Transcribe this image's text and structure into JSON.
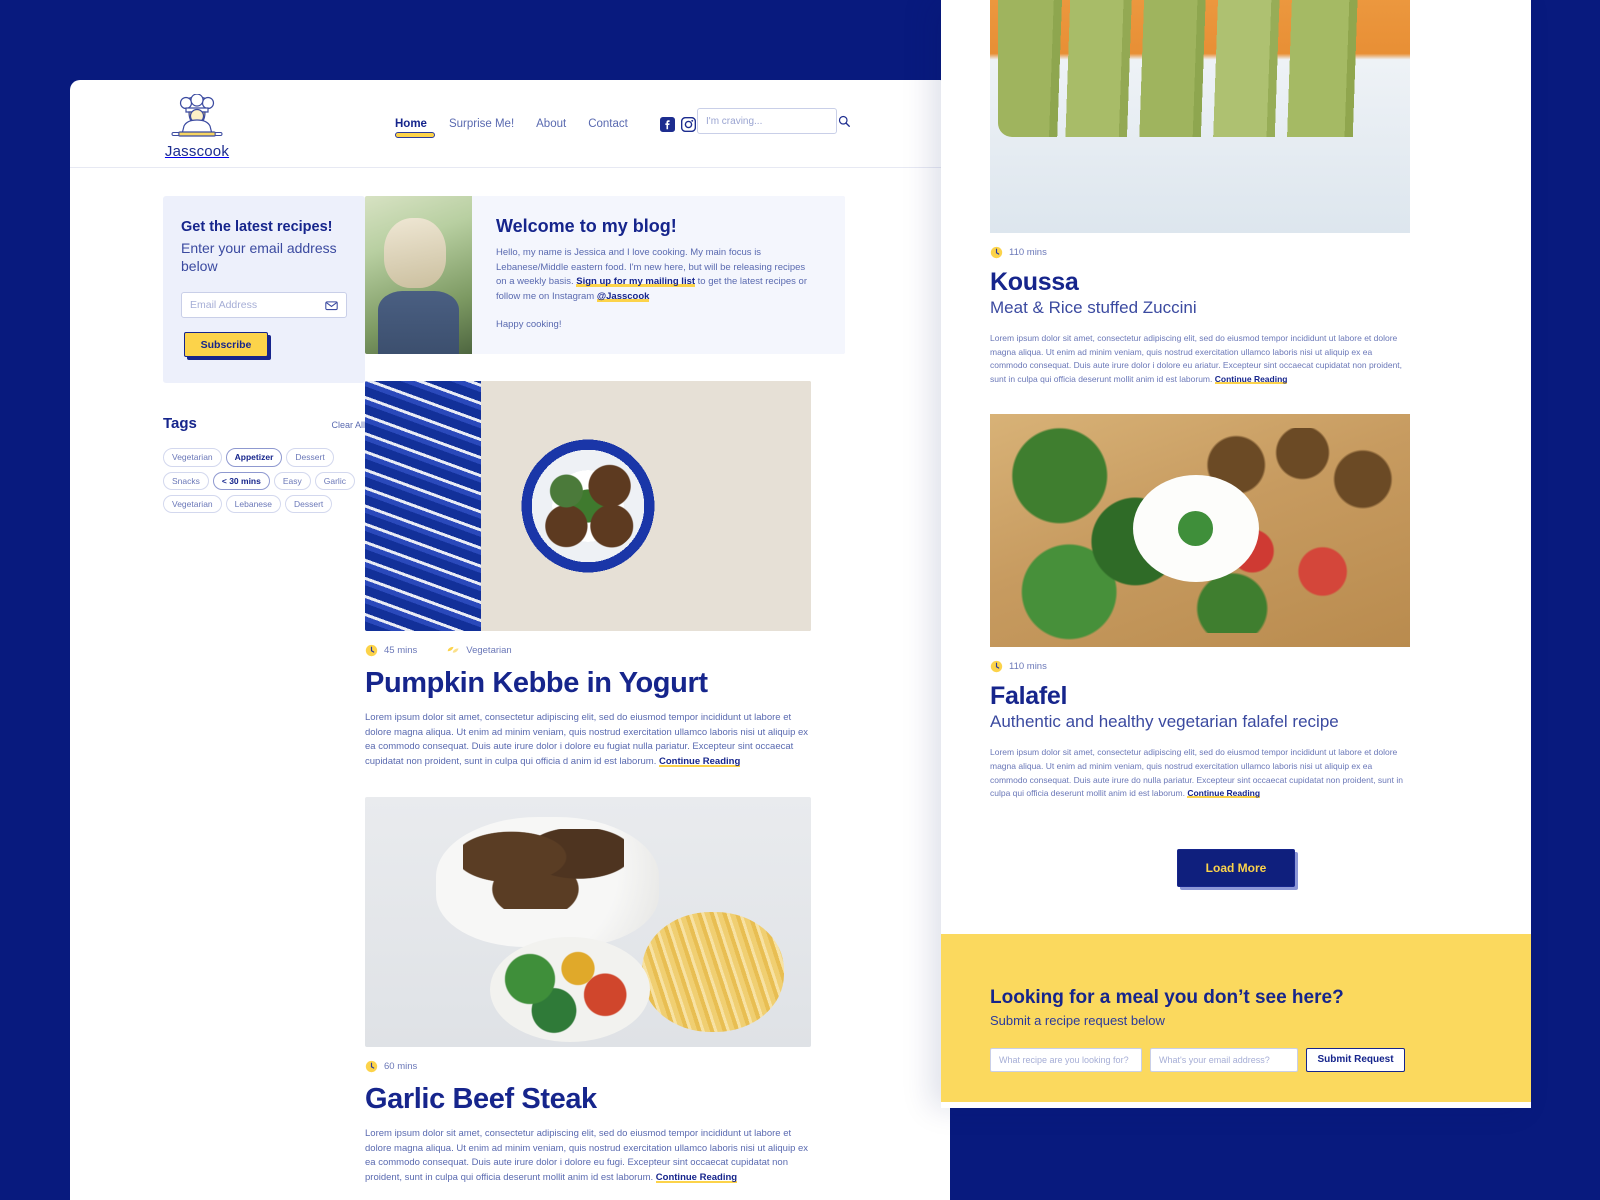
{
  "brand": {
    "name": "Jasscook",
    "logo_icon": "chef-logo-icon",
    "navy": "#16258c",
    "yellow": "#fcd34a",
    "page_bg": "#081a7e"
  },
  "nav": {
    "items": [
      {
        "label": "Home",
        "active": true
      },
      {
        "label": "Surprise Me!",
        "active": false
      },
      {
        "label": "About",
        "active": false
      },
      {
        "label": "Contact",
        "active": false
      }
    ],
    "socials": [
      {
        "name": "facebook-icon"
      },
      {
        "name": "instagram-icon"
      },
      {
        "name": "pinterest-icon"
      }
    ],
    "search": {
      "placeholder": "I'm craving...",
      "value": "",
      "icon": "search-icon"
    }
  },
  "sidebar": {
    "subscribe": {
      "title": "Get the latest recipes!",
      "subtitle": "Enter your email address below",
      "email_placeholder": "Email Address",
      "email_value": "",
      "mail_icon": "envelope-icon",
      "button_label": "Subscribe"
    },
    "tags": {
      "title": "Tags",
      "clear_label": "Clear All",
      "items": [
        {
          "label": "Vegetarian",
          "selected": false
        },
        {
          "label": "Appetizer",
          "selected": true
        },
        {
          "label": "Dessert",
          "selected": false
        },
        {
          "label": "Snacks",
          "selected": false
        },
        {
          "label": "< 30 mins",
          "selected": true
        },
        {
          "label": "Easy",
          "selected": false
        },
        {
          "label": "Garlic",
          "selected": false
        },
        {
          "label": "Vegetarian",
          "selected": false
        },
        {
          "label": "Lebanese",
          "selected": false
        },
        {
          "label": "Dessert",
          "selected": false
        }
      ]
    }
  },
  "welcome": {
    "title": "Welcome to my blog!",
    "image": "jessica-portrait",
    "text_part1": "Hello, my name is Jessica and I love cooking. My main focus is Lebanese/Middle eastern food. I'm new here, but will be releasing recipes on a weekly basis. ",
    "link1": "Sign up for my mailing list",
    "text_part2": " to get the latest recipes or follow me on Instagram ",
    "link2": "@Jasscook",
    "closing": "Happy cooking!"
  },
  "left_recipes": [
    {
      "image": "pumpkin-kebbe-photo",
      "time": "45 mins",
      "time_icon": "clock-icon",
      "diet": "Vegetarian",
      "diet_icon": "leaf-icon",
      "title": "Pumpkin Kebbe in Yogurt",
      "body": "Lorem ipsum dolor sit amet, consectetur adipiscing elit, sed do eiusmod tempor incididunt ut labore et dolore magna aliqua. Ut enim ad minim veniam, quis nostrud exercitation ullamco laboris nisi ut aliquip ex ea commodo consequat. Duis aute irure dolor i dolore eu fugiat nulla pariatur. Excepteur sint occaecat cupidatat non proident, sunt in culpa qui officia d anim id est laborum. ",
      "link": "Continue Reading"
    },
    {
      "image": "garlic-beef-steak-photo",
      "time": "60 mins",
      "time_icon": "clock-icon",
      "diet": "",
      "diet_icon": "",
      "title": "Garlic Beef Steak",
      "body": "Lorem ipsum dolor sit amet, consectetur adipiscing elit, sed do eiusmod tempor incididunt ut labore et dolore magna aliqua. Ut enim ad minim veniam, quis nostrud exercitation ullamco laboris nisi ut aliquip ex ea commodo consequat. Duis aute irure dolor i dolore eu fugi. Excepteur sint occaecat cupidatat non proident, sunt in culpa qui officia deserunt mollit anim id est laborum. ",
      "link": "Continue Reading"
    }
  ],
  "right_recipes": [
    {
      "image": "koussa-zucchini-photo",
      "time": "110 mins",
      "time_icon": "clock-icon",
      "title": "Koussa",
      "subtitle": "Meat & Rice stuffed Zuccini",
      "body": "Lorem ipsum dolor sit amet, consectetur adipiscing elit, sed do eiusmod tempor incididunt ut labore et dolore magna aliqua. Ut enim ad minim veniam, quis nostrud exercitation ullamco laboris nisi ut aliquip ex ea commodo consequat. Duis aute irure dolor i dolore eu ariatur. Excepteur sint occaecat cupidatat non proident, sunt in culpa qui officia deserunt mollit anim id est laborum. ",
      "link": "Continue Reading"
    },
    {
      "image": "falafel-platter-photo",
      "time": "110 mins",
      "time_icon": "clock-icon",
      "title": "Falafel",
      "subtitle": "Authentic and healthy vegetarian falafel recipe",
      "body": "Lorem ipsum dolor sit amet, consectetur adipiscing elit, sed do eiusmod tempor incididunt ut labore et dolore magna aliqua. Ut enim ad minim veniam, quis nostrud exercitation ullamco laboris nisi ut aliquip ex ea commodo consequat. Duis aute irure do nulla pariatur. Excepteur sint occaecat cupidatat non proident, sunt in culpa qui officia deserunt mollit anim id est laborum. ",
      "link": "Continue Reading"
    }
  ],
  "load_more": {
    "label": "Load More"
  },
  "cta": {
    "title": "Looking for a meal you don’t see here?",
    "subtitle": "Submit a recipe request below",
    "recipe_placeholder": "What recipe are you looking for?",
    "recipe_value": "",
    "email_placeholder": "What's your email address?",
    "email_value": "",
    "button_label": "Submit Request"
  }
}
